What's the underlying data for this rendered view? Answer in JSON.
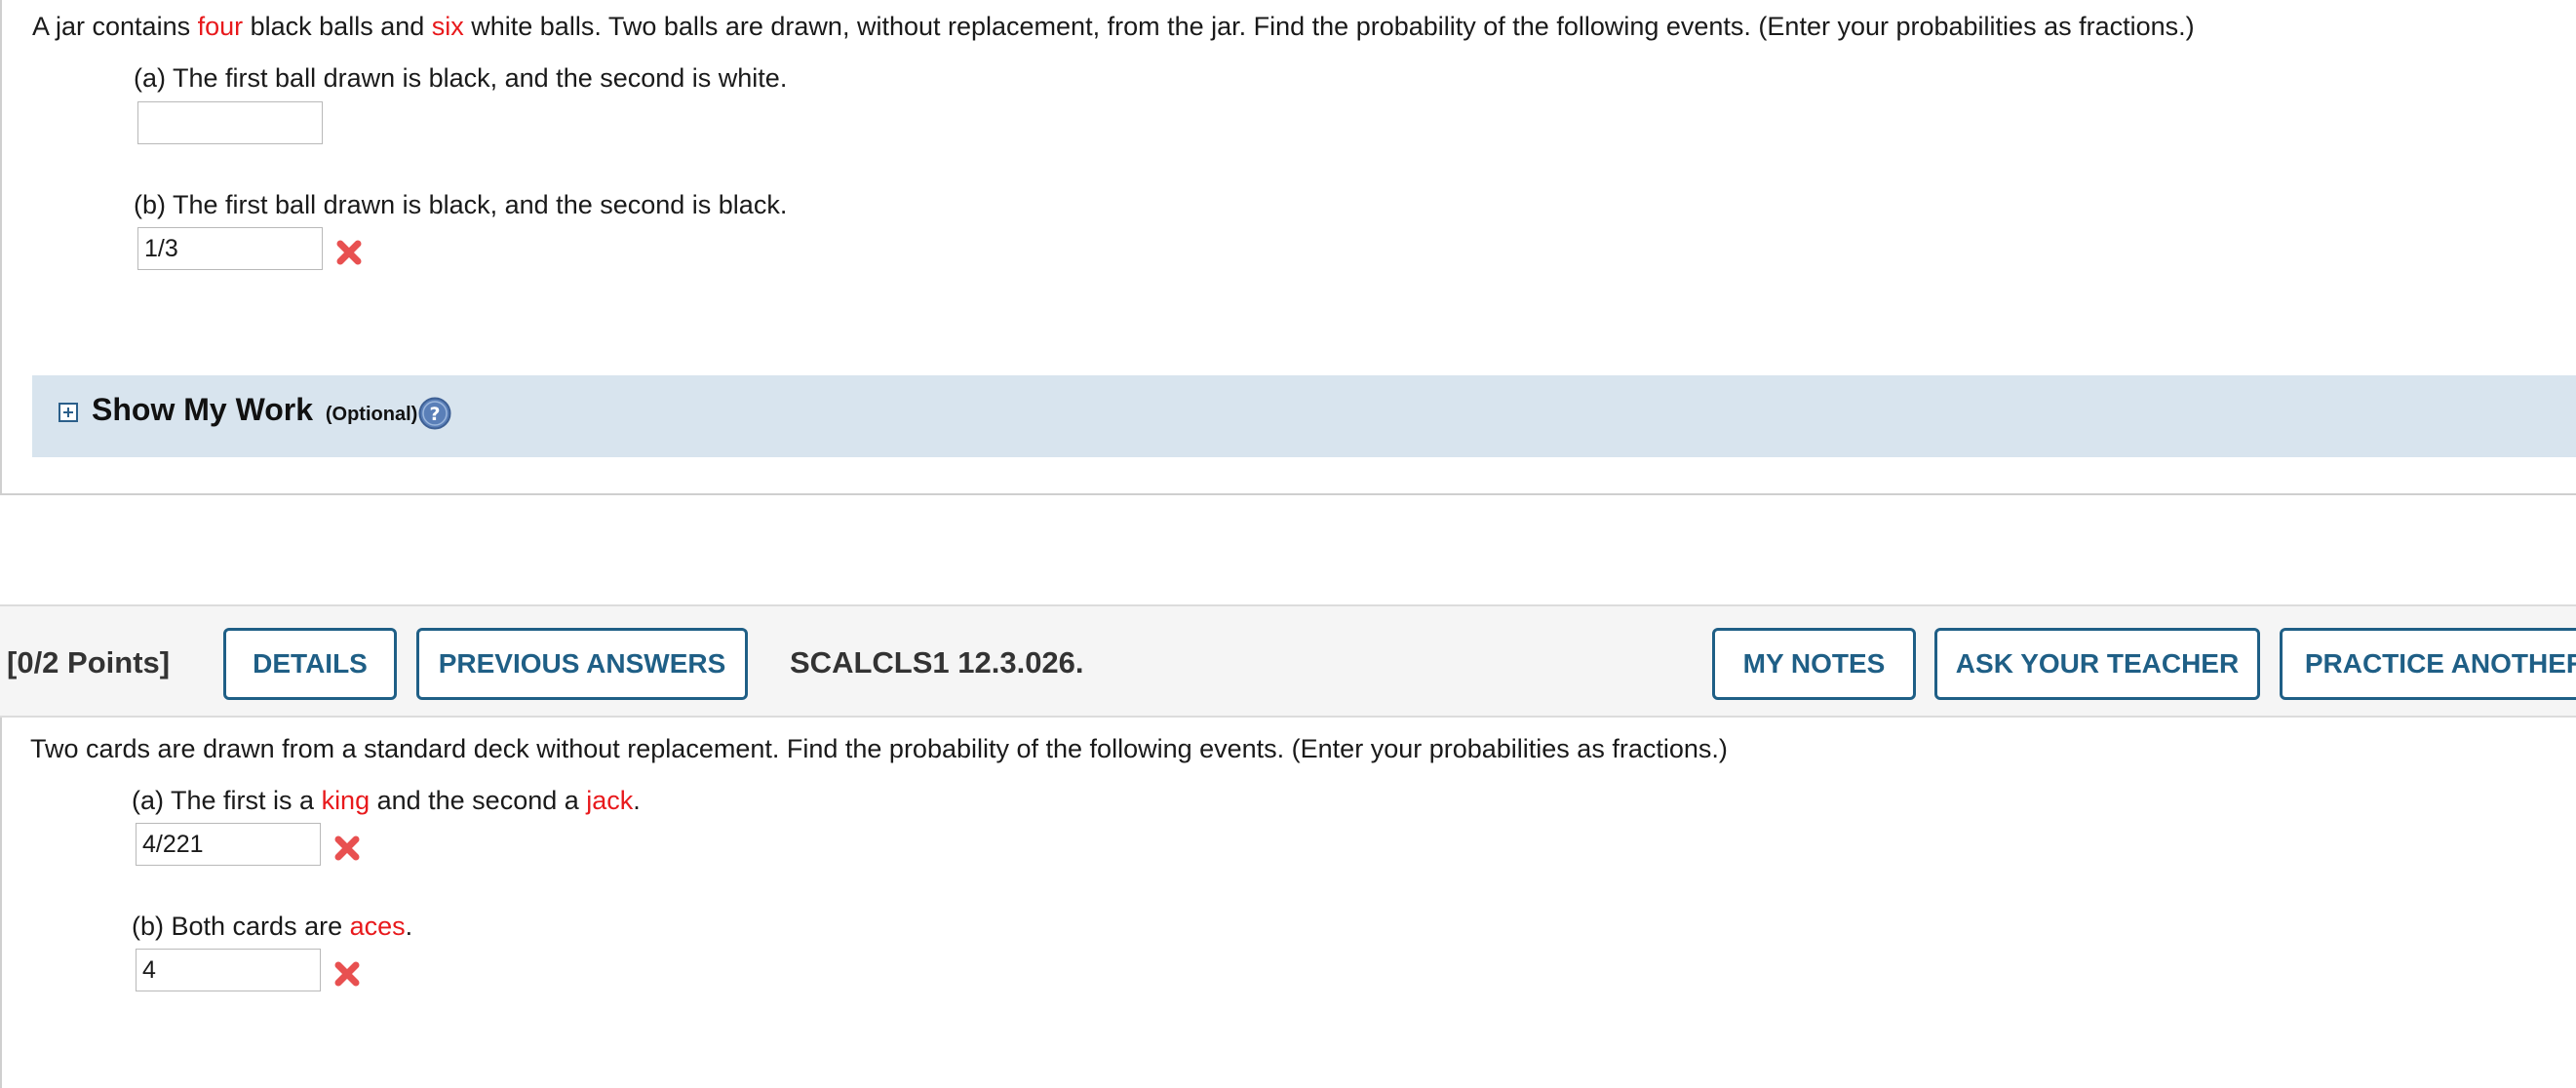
{
  "q1": {
    "intro_before_four": "A jar contains ",
    "four": "four",
    "intro_mid": " black balls and ",
    "six": "six",
    "intro_after": " white balls. Two balls are drawn, without replacement, from the jar. Find the probability of the following events. (Enter your probabilities as fractions.)",
    "part_a": {
      "label": "(a) The first ball drawn is black, and the second is white.",
      "value": ""
    },
    "part_b": {
      "label": "(b) The first ball drawn is black, and the second is black.",
      "value": "1/3",
      "status": "incorrect"
    }
  },
  "show_my_work": {
    "title": "Show My Work",
    "optional": "(Optional)",
    "expand_icon": "plus-box-icon",
    "help_icon": "question-circle-icon"
  },
  "q2_header": {
    "points": "[0/2 Points]",
    "details_label": "DETAILS",
    "previous_answers_label": "PREVIOUS ANSWERS",
    "question_id": "SCALCLS1 12.3.026.",
    "my_notes_label": "MY NOTES",
    "ask_teacher_label": "ASK YOUR TEACHER",
    "practice_another_label": "PRACTICE ANOTHER"
  },
  "q2": {
    "intro": "Two cards are drawn from a standard deck without replacement. Find the probability of the following events. (Enter your probabilities as fractions.)",
    "part_a": {
      "prefix": "(a) The first is a ",
      "king": "king",
      "mid": " and the second a ",
      "jack": "jack",
      "suffix": ".",
      "value": "4/221",
      "status": "incorrect"
    },
    "part_b": {
      "prefix": "(b) Both cards are ",
      "aces": "aces",
      "suffix": ".",
      "value": "4",
      "status": "incorrect"
    }
  },
  "colors": {
    "accent_red": "#e8191c",
    "button_blue": "#1f5f86",
    "work_bar_bg": "#d8e4ee",
    "wrong_icon": "#e85050"
  }
}
